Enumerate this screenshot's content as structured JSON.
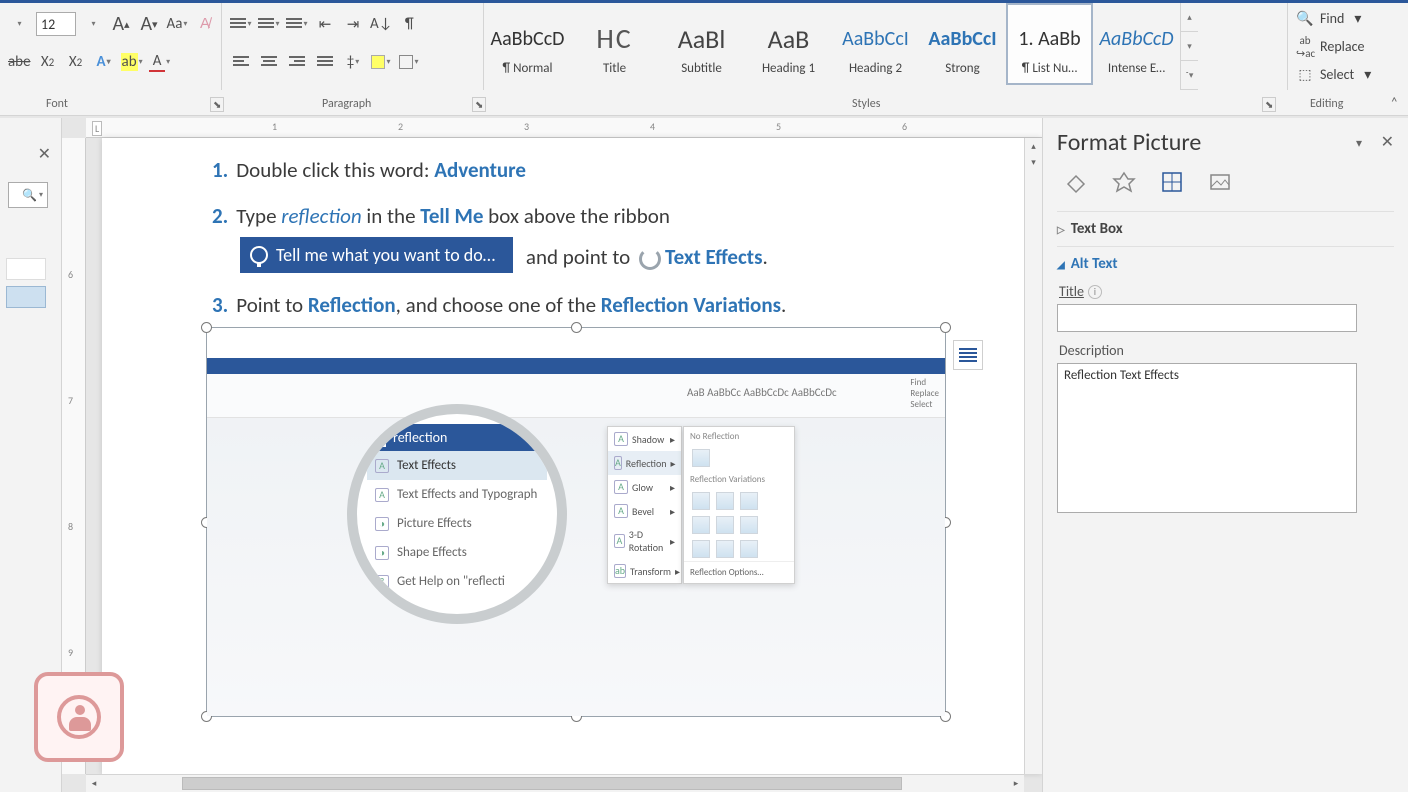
{
  "ribbon": {
    "font_size": "12",
    "groups": {
      "font": "Font",
      "paragraph": "Paragraph",
      "styles": "Styles",
      "editing": "Editing"
    },
    "styles": [
      {
        "preview": "AaBbCcD",
        "name": "¶ Normal",
        "cls": ""
      },
      {
        "preview": "HC",
        "name": "Title",
        "cls": "huge"
      },
      {
        "preview": "AaBl",
        "name": "Subtitle",
        "cls": "big2"
      },
      {
        "preview": "AaB",
        "name": "Heading 1",
        "cls": "big2"
      },
      {
        "preview": "AaBbCcI",
        "name": "Heading 2",
        "cls": "blue"
      },
      {
        "preview": "AaBbCcI",
        "name": "Strong",
        "cls": "bluebold"
      },
      {
        "preview": "1.  AaBb",
        "name": "¶ List Nu…",
        "cls": ""
      },
      {
        "preview": "AaBbCcD",
        "name": "Intense E…",
        "cls": "italblue"
      }
    ],
    "selected_style_index": 6,
    "editing": {
      "find": "Find",
      "replace": "Replace",
      "select": "Select"
    }
  },
  "ruler_marks": [
    "1",
    "2",
    "3",
    "4",
    "5",
    "6"
  ],
  "vruler_marks": [
    "6",
    "7",
    "8",
    "9"
  ],
  "doc": {
    "l1_pre": "Double click this word: ",
    "l1_kw": "Adventure",
    "l2_pre": "Type ",
    "l2_ital": "reflection",
    "l2_mid": " in the ",
    "l2_kw": "Tell Me",
    "l2_post": " box above the ribbon",
    "tellme": "Tell me what you want to do…",
    "l2b_pre": " and point to ",
    "l2b_kw": "Text Effects",
    "l2b_post": ".",
    "l3_pre": "Point to ",
    "l3_kw1": "Reflection",
    "l3_mid": ", and choose one of the ",
    "l3_kw2": "Reflection Variations",
    "l3_post": "."
  },
  "magnifier": {
    "search": "reflection",
    "items": [
      "Text Effects",
      "Text Effects and Typograph",
      "Picture Effects",
      "Shape Effects",
      "Get Help on \"reflecti"
    ]
  },
  "flyout1": [
    "Shadow",
    "Reflection",
    "Glow",
    "Bevel",
    "3-D Rotation",
    "Transform"
  ],
  "flyout2": {
    "hdr1": "No Reflection",
    "hdr2": "Reflection Variations",
    "opt": "Reflection Options…"
  },
  "pic_ribbon_preview": "AaB  AaBbCc AaBbCcDc AaBbCcDc",
  "pic_right_items": [
    "Find",
    "Replace",
    "Select"
  ],
  "format_pane": {
    "title": "Format Picture",
    "sec_textbox": "Text Box",
    "sec_alttext": "Alt Text",
    "label_title": "Title",
    "label_desc": "Description",
    "title_value": "",
    "desc_value": "Reflection Text Effects"
  }
}
